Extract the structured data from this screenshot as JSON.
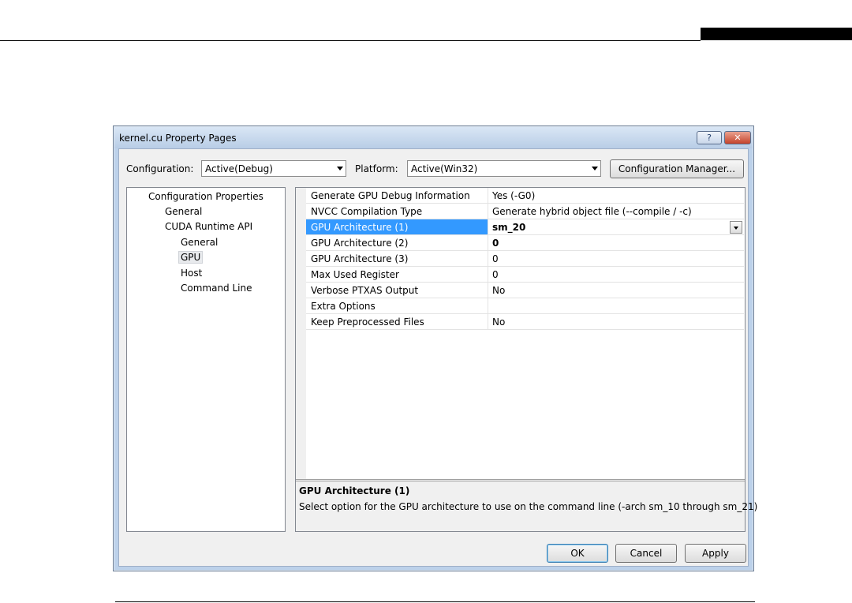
{
  "window": {
    "title": "kernel.cu Property Pages",
    "help_glyph": "?",
    "close_glyph": "✕"
  },
  "toolbar": {
    "configuration_label": "Configuration:",
    "configuration_value": "Active(Debug)",
    "platform_label": "Platform:",
    "platform_value": "Active(Win32)",
    "config_manager_label": "Configuration Manager..."
  },
  "tree": {
    "items": [
      {
        "label": "Configuration Properties",
        "level": 0
      },
      {
        "label": "General",
        "level": 1
      },
      {
        "label": "CUDA Runtime API",
        "level": 1
      },
      {
        "label": "General",
        "level": 2
      },
      {
        "label": "GPU",
        "level": 2,
        "selected": true
      },
      {
        "label": "Host",
        "level": 2
      },
      {
        "label": "Command Line",
        "level": 2
      }
    ]
  },
  "properties": {
    "rows": [
      {
        "name": "Generate GPU Debug Information",
        "value": "Yes (-G0)"
      },
      {
        "name": "NVCC Compilation Type",
        "value": "Generate hybrid object file  (--compile / -c)"
      },
      {
        "name": "GPU Architecture (1)",
        "value": "sm_20"
      },
      {
        "name": "GPU Architecture (2)",
        "value": "0"
      },
      {
        "name": "GPU Architecture (3)",
        "value": "0"
      },
      {
        "name": "Max Used Register",
        "value": "0"
      },
      {
        "name": "Verbose PTXAS Output",
        "value": "No"
      },
      {
        "name": "Extra Options",
        "value": ""
      },
      {
        "name": "Keep Preprocessed Files",
        "value": "No"
      }
    ]
  },
  "description": {
    "title": "GPU Architecture (1)",
    "text": "Select option for the GPU architecture to use on the command line (-arch sm_10 through sm_21)"
  },
  "buttons": {
    "ok": "OK",
    "cancel": "Cancel",
    "apply": "Apply"
  },
  "colors": {
    "selection": "#3399ff",
    "title_gradient_top": "#d9e6f5",
    "close_button": "#c4432b"
  }
}
